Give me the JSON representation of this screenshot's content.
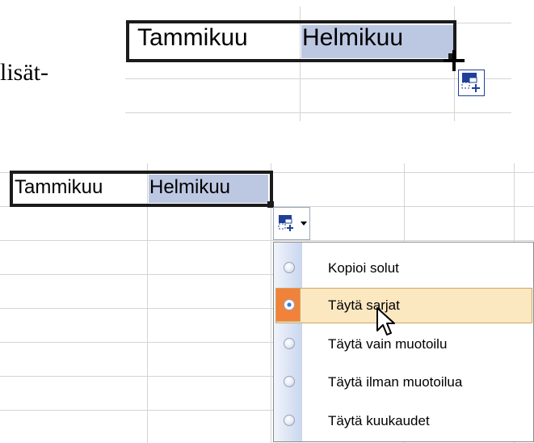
{
  "instruction": {
    "text_fragment": "lisät-"
  },
  "top_example": {
    "cells": [
      "Tammikuu",
      "Helmikuu"
    ]
  },
  "bottom_example": {
    "cells": [
      "Tammikuu",
      "Helmikuu"
    ],
    "autofill_options_menu": [
      {
        "label": "Kopioi solut",
        "selected": false
      },
      {
        "label": "Täytä sarjat",
        "selected": true
      },
      {
        "label": "Täytä vain muotoilu",
        "selected": false
      },
      {
        "label": "Täytä ilman muotoilua",
        "selected": false
      },
      {
        "label": "Täytä kuukaudet",
        "selected": false
      }
    ]
  },
  "colors": {
    "selection_fill": "#bcc7e2",
    "highlight_fill": "#fbe7c0",
    "highlight_radio_bg": "#f2813a",
    "grid_line": "#d4d4d4"
  },
  "icons": [
    "auto-fill-options-icon",
    "plus-cursor-icon",
    "dropdown-arrow-icon",
    "mouse-pointer-icon"
  ]
}
